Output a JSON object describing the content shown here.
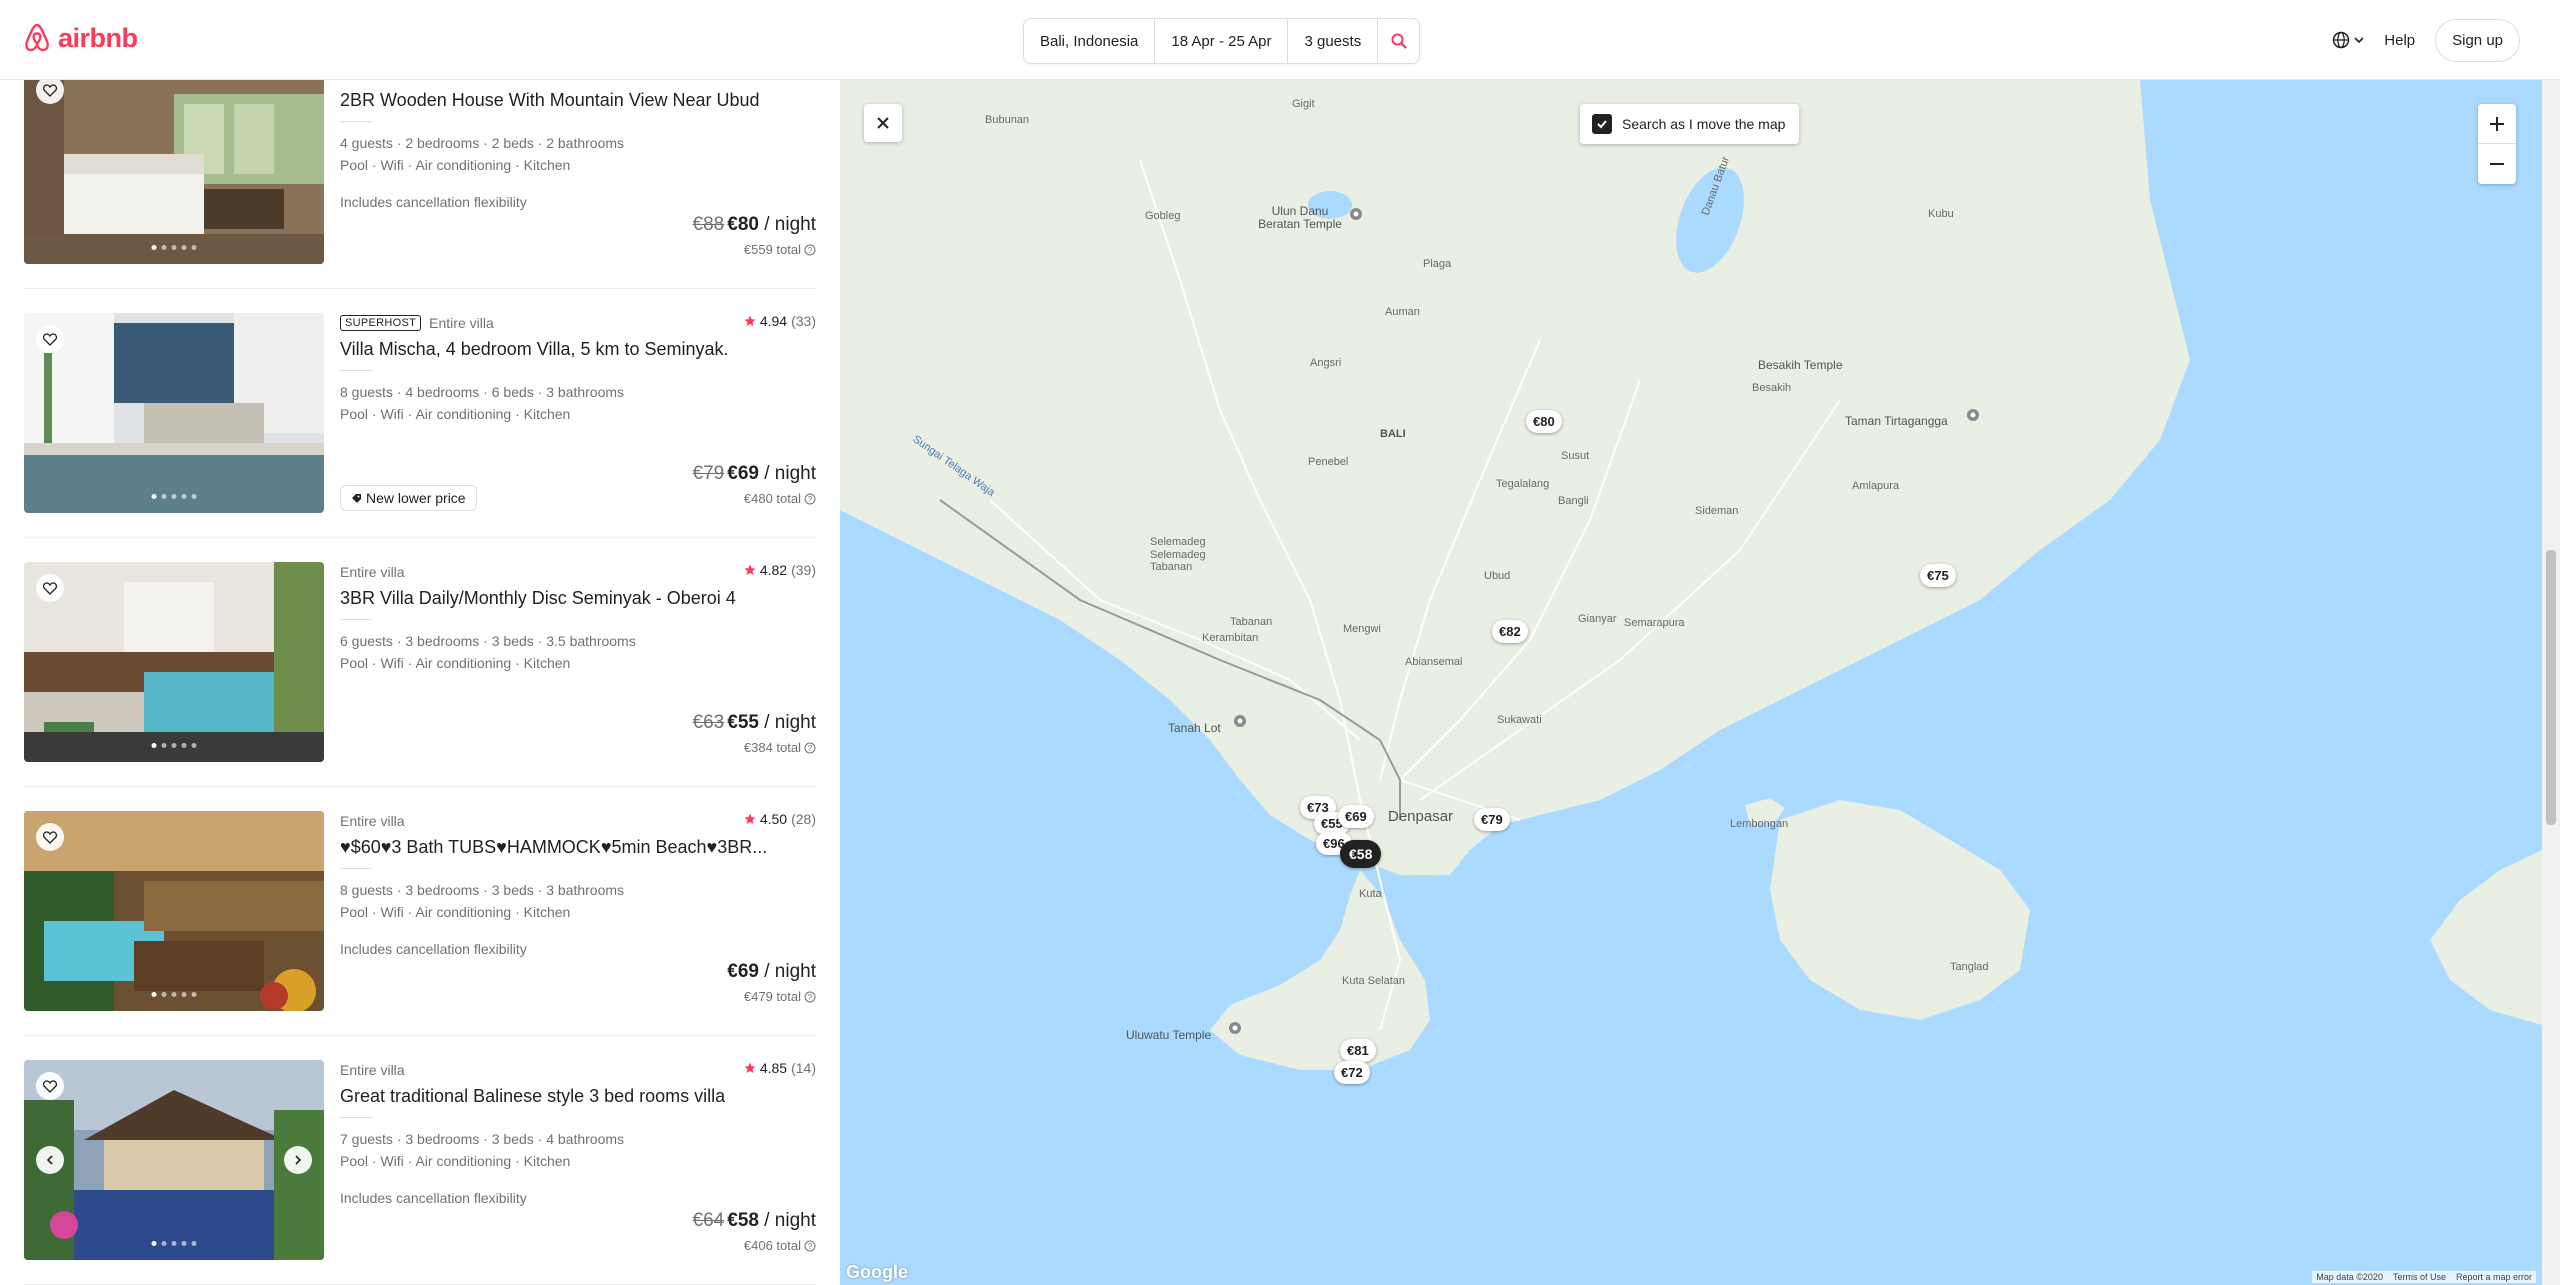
{
  "header": {
    "logo_text": "airbnb",
    "search": {
      "location": "Bali, Indonesia",
      "dates": "18 Apr - 25 Apr",
      "guests": "3 guests"
    },
    "help": "Help",
    "signup": "Sign up"
  },
  "listings": [
    {
      "badge": "",
      "type": "",
      "rating": "",
      "reviews": "",
      "title": "2BR Wooden House With Mountain View Near Ubud",
      "details": "4 guests · 2 bedrooms · 2 beds · 2 bathrooms",
      "amenities": "Pool · Wifi · Air conditioning · Kitchen",
      "note": "Includes cancellation flexibility",
      "old_price": "€88",
      "price": "€80",
      "per_night": " / night",
      "total": "€559 total"
    },
    {
      "badge": "SUPERHOST",
      "type": "Entire villa",
      "rating": "4.94",
      "reviews": "(33)",
      "title": "Villa Mischa, 4 bedroom Villa, 5 km to Seminyak.",
      "details": "8 guests · 4 bedrooms · 6 beds · 3 bathrooms",
      "amenities": "Pool · Wifi · Air conditioning · Kitchen",
      "note": "New lower price",
      "old_price": "€79",
      "price": "€69",
      "per_night": " / night",
      "total": "€480 total"
    },
    {
      "badge": "",
      "type": "Entire villa",
      "rating": "4.82",
      "reviews": "(39)",
      "title": "3BR Villa Daily/Monthly Disc Seminyak - Oberoi 4",
      "details": "6 guests · 3 bedrooms · 3 beds · 3.5 bathrooms",
      "amenities": "Pool · Wifi · Air conditioning · Kitchen",
      "note": "",
      "old_price": "€63",
      "price": "€55",
      "per_night": " / night",
      "total": "€384 total"
    },
    {
      "badge": "",
      "type": "Entire villa",
      "rating": "4.50",
      "reviews": "(28)",
      "title": "♥$60♥3 Bath TUBS♥HAMMOCK♥5min Beach♥3BR...",
      "details": "8 guests · 3 bedrooms · 3 beds · 3 bathrooms",
      "amenities": "Pool · Wifi · Air conditioning · Kitchen",
      "note": "Includes cancellation flexibility",
      "old_price": "",
      "price": "€69",
      "per_night": " / night",
      "total": "€479 total"
    },
    {
      "badge": "",
      "type": "Entire villa",
      "rating": "4.85",
      "reviews": "(14)",
      "title": "Great traditional Balinese style 3 bed rooms villa",
      "details": "7 guests · 3 bedrooms · 3 beds · 4 bathrooms",
      "amenities": "Pool · Wifi · Air conditioning · Kitchen",
      "note": "Includes cancellation flexibility",
      "old_price": "€64",
      "price": "€58",
      "per_night": " / night",
      "total": "€406 total"
    }
  ],
  "map": {
    "toggle_label": "Search as I move the map",
    "google": "Google",
    "footer": [
      "Map data ©2020",
      "Terms of Use",
      "Report a map error"
    ],
    "places": [
      "Gigit",
      "Bubunan",
      "Ulun Danu Beratan Temple",
      "Gobleg",
      "Danau Batur",
      "Kubu",
      "Plaga",
      "Auman",
      "Angsri",
      "Besakih Temple",
      "Besakih",
      "Taman Tirtagangga",
      "BALI",
      "Penebel",
      "Susut",
      "Bangli",
      "Amlapura",
      "Tegalalang",
      "Sideman",
      "Selemadeg",
      "Selemadeg Tabanan",
      "Ubud",
      "Gianyar",
      "Semarapura",
      "Tabanan",
      "Kerambitan",
      "Mengwi",
      "Abiansemal",
      "Tanah Lot",
      "Sukawati",
      "Denpasar",
      "Lembongan",
      "Kuta",
      "Kuta Selatan",
      "Tanglad",
      "Uluwatu Temple",
      "Sungai Telaga Waja"
    ],
    "pins": [
      "€80",
      "€75",
      "€82",
      "€79",
      "€73",
      "€55",
      "€69",
      "€96",
      "€58",
      "€81",
      "€72"
    ]
  },
  "colors": {
    "brand": "#ff385c",
    "sea": "#aadaff",
    "land": "#e8eee1"
  }
}
